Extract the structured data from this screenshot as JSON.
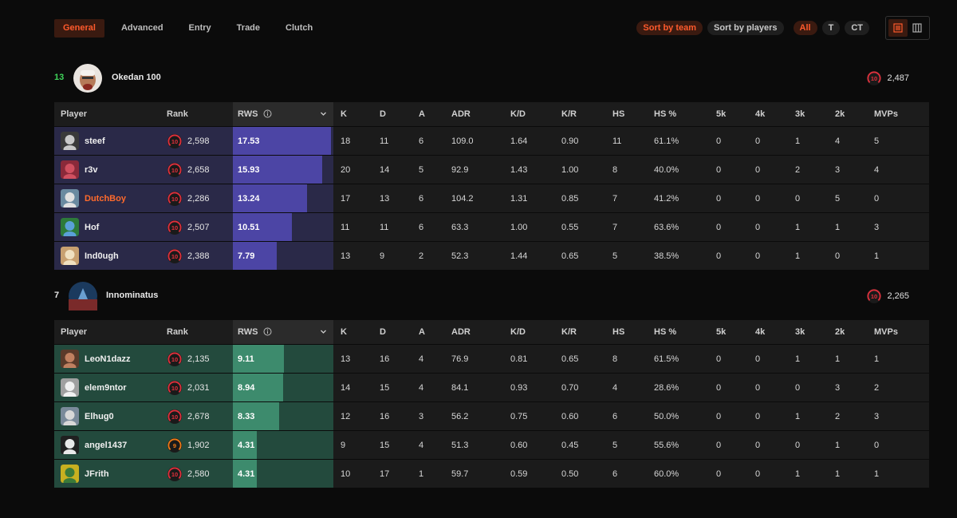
{
  "tabs": [
    {
      "label": "General",
      "active": true
    },
    {
      "label": "Advanced",
      "active": false
    },
    {
      "label": "Entry",
      "active": false
    },
    {
      "label": "Trade",
      "active": false
    },
    {
      "label": "Clutch",
      "active": false
    }
  ],
  "sort": {
    "by_team": "Sort by team",
    "by_players": "Sort by players"
  },
  "sides": {
    "all": "All",
    "t": "T",
    "ct": "CT"
  },
  "view_icons": [
    "list-view-icon",
    "grid-view-icon"
  ],
  "colors": {
    "accent": "#ff5a2c",
    "team1_bg": "#2a2948",
    "team1_bar": "#4c45a5",
    "team2_bg": "#234a3d",
    "team2_bar": "#3d8b6d",
    "win_score": "#3fd45a",
    "level10": "#e0303c",
    "level9": "#f07a16"
  },
  "columns": [
    "Player",
    "Rank",
    "RWS",
    "K",
    "D",
    "A",
    "ADR",
    "K/D",
    "K/R",
    "HS",
    "HS %",
    "5k",
    "4k",
    "3k",
    "2k",
    "MVPs"
  ],
  "rws_max": 18,
  "teams": [
    {
      "score": "13",
      "name": "Okedan 100",
      "elo": "2,487",
      "level": "10",
      "players": [
        {
          "name": "steef",
          "level": "10",
          "elo": "2,598",
          "rws": "17.53",
          "rws_value": 17.53,
          "k": "18",
          "d": "11",
          "a": "6",
          "adr": "109.0",
          "kd": "1.64",
          "kr": "0.90",
          "hs": "11",
          "hsp": "61.1%",
          "k5": "0",
          "k4": "0",
          "k3": "1",
          "k2": "4",
          "mvps": "5",
          "highlight": false
        },
        {
          "name": "r3v",
          "level": "10",
          "elo": "2,658",
          "rws": "15.93",
          "rws_value": 15.93,
          "k": "20",
          "d": "14",
          "a": "5",
          "adr": "92.9",
          "kd": "1.43",
          "kr": "1.00",
          "hs": "8",
          "hsp": "40.0%",
          "k5": "0",
          "k4": "0",
          "k3": "2",
          "k2": "3",
          "mvps": "4",
          "highlight": false
        },
        {
          "name": "DutchBoy",
          "level": "10",
          "elo": "2,286",
          "rws": "13.24",
          "rws_value": 13.24,
          "k": "17",
          "d": "13",
          "a": "6",
          "adr": "104.2",
          "kd": "1.31",
          "kr": "0.85",
          "hs": "7",
          "hsp": "41.2%",
          "k5": "0",
          "k4": "0",
          "k3": "0",
          "k2": "5",
          "mvps": "0",
          "highlight": true
        },
        {
          "name": "Hof",
          "level": "10",
          "elo": "2,507",
          "rws": "10.51",
          "rws_value": 10.51,
          "k": "11",
          "d": "11",
          "a": "6",
          "adr": "63.3",
          "kd": "1.00",
          "kr": "0.55",
          "hs": "7",
          "hsp": "63.6%",
          "k5": "0",
          "k4": "0",
          "k3": "1",
          "k2": "1",
          "mvps": "3",
          "highlight": false
        },
        {
          "name": "Ind0ugh",
          "level": "10",
          "elo": "2,388",
          "rws": "7.79",
          "rws_value": 7.79,
          "k": "13",
          "d": "9",
          "a": "2",
          "adr": "52.3",
          "kd": "1.44",
          "kr": "0.65",
          "hs": "5",
          "hsp": "38.5%",
          "k5": "0",
          "k4": "0",
          "k3": "1",
          "k2": "0",
          "mvps": "1",
          "highlight": false
        }
      ]
    },
    {
      "score": "7",
      "name": "Innominatus",
      "elo": "2,265",
      "level": "10",
      "players": [
        {
          "name": "LeoN1dazz",
          "level": "10",
          "elo": "2,135",
          "rws": "9.11",
          "rws_value": 9.11,
          "k": "13",
          "d": "16",
          "a": "4",
          "adr": "76.9",
          "kd": "0.81",
          "kr": "0.65",
          "hs": "8",
          "hsp": "61.5%",
          "k5": "0",
          "k4": "0",
          "k3": "1",
          "k2": "1",
          "mvps": "1",
          "highlight": false
        },
        {
          "name": "elem9ntor",
          "level": "10",
          "elo": "2,031",
          "rws": "8.94",
          "rws_value": 8.94,
          "k": "14",
          "d": "15",
          "a": "4",
          "adr": "84.1",
          "kd": "0.93",
          "kr": "0.70",
          "hs": "4",
          "hsp": "28.6%",
          "k5": "0",
          "k4": "0",
          "k3": "0",
          "k2": "3",
          "mvps": "2",
          "highlight": false
        },
        {
          "name": "Elhug0",
          "level": "10",
          "elo": "2,678",
          "rws": "8.33",
          "rws_value": 8.33,
          "k": "12",
          "d": "16",
          "a": "3",
          "adr": "56.2",
          "kd": "0.75",
          "kr": "0.60",
          "hs": "6",
          "hsp": "50.0%",
          "k5": "0",
          "k4": "0",
          "k3": "1",
          "k2": "2",
          "mvps": "3",
          "highlight": false
        },
        {
          "name": "angel1437",
          "level": "9",
          "elo": "1,902",
          "rws": "4.31",
          "rws_value": 4.31,
          "k": "9",
          "d": "15",
          "a": "4",
          "adr": "51.3",
          "kd": "0.60",
          "kr": "0.45",
          "hs": "5",
          "hsp": "55.6%",
          "k5": "0",
          "k4": "0",
          "k3": "0",
          "k2": "1",
          "mvps": "0",
          "highlight": false
        },
        {
          "name": "JFrith",
          "level": "10",
          "elo": "2,580",
          "rws": "4.31",
          "rws_value": 4.31,
          "k": "10",
          "d": "17",
          "a": "1",
          "adr": "59.7",
          "kd": "0.59",
          "kr": "0.50",
          "hs": "6",
          "hsp": "60.0%",
          "k5": "0",
          "k4": "0",
          "k3": "1",
          "k2": "1",
          "mvps": "1",
          "highlight": false
        }
      ]
    }
  ]
}
